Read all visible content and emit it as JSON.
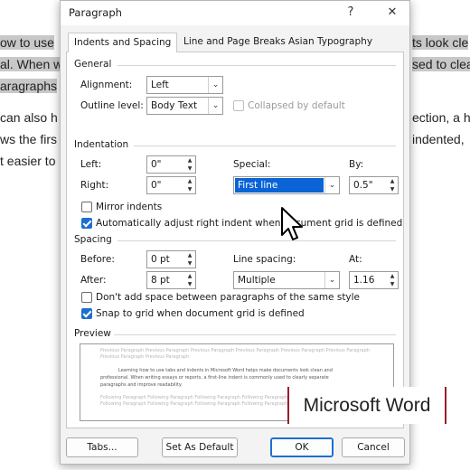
{
  "background_doc": {
    "lines": [
      {
        "left": "ow to use",
        "right": "ts look cle"
      },
      {
        "left": "al. When w",
        "right": "sed to clea"
      },
      {
        "left": "aragraphs",
        "right": ""
      },
      {
        "left": "can also h",
        "right": "ection, a h"
      },
      {
        "left": "ws the firs",
        "right": "indented,"
      },
      {
        "left": "t easier to",
        "right": ""
      }
    ]
  },
  "dialog": {
    "title": "Paragraph",
    "help_icon": "?",
    "close_icon": "✕",
    "tabs": [
      {
        "label": "Indents and Spacing",
        "active": true
      },
      {
        "label": "Line and Page Breaks",
        "active": false
      },
      {
        "label": "Asian Typography",
        "active": false
      }
    ],
    "general": {
      "heading": "General",
      "alignment_label": "Alignment:",
      "alignment_value": "Left",
      "outline_label": "Outline level:",
      "outline_value": "Body Text",
      "collapsed_label": "Collapsed by default",
      "collapsed_checked": false
    },
    "indentation": {
      "heading": "Indentation",
      "left_label": "Left:",
      "left_value": "0\"",
      "right_label": "Right:",
      "right_value": "0\"",
      "special_label": "Special:",
      "special_value": "First line",
      "by_label": "By:",
      "by_value": "0.5\"",
      "mirror_label": "Mirror indents",
      "mirror_checked": false,
      "auto_adjust_label": "Automatically adjust right indent when document grid is defined",
      "auto_adjust_checked": true
    },
    "spacing": {
      "heading": "Spacing",
      "before_label": "Before:",
      "before_value": "0 pt",
      "after_label": "After:",
      "after_value": "8 pt",
      "line_spacing_label": "Line spacing:",
      "line_spacing_value": "Multiple",
      "at_label": "At:",
      "at_value": "1.16",
      "no_space_label": "Don't add space between paragraphs of the same style",
      "no_space_checked": false,
      "snap_label": "Snap to grid when document grid is defined",
      "snap_checked": true
    },
    "preview": {
      "heading": "Preview",
      "prev_para": "Previous Paragraph Previous Paragraph Previous Paragraph Previous Paragraph Previous Paragraph Previous Paragraph",
      "prev_para2": "Previous Paragraph Previous Paragraph",
      "sample_1": "Learning how to use tabs and indents in Microsoft Word helps make documents look clean and",
      "sample_2": "professional. When writing essays or reports, a first-line indent is commonly used to clearly separate",
      "sample_3": "paragraphs and improve readability.",
      "next_para": "Following Paragraph Following Paragraph Following Paragraph Following Paragraph Following Paragraph",
      "next_para2": "Following Paragraph Following Paragraph Following Paragraph Following Paragraph Following Paragraph"
    },
    "buttons": {
      "tabs": "Tabs...",
      "set_default": "Set As Default",
      "ok": "OK",
      "cancel": "Cancel"
    }
  },
  "watermark": "Microsoft Word",
  "colors": {
    "accent": "#1d6fcf",
    "selection": "#0a64d6",
    "watermark_border": "#9b1c2b"
  }
}
